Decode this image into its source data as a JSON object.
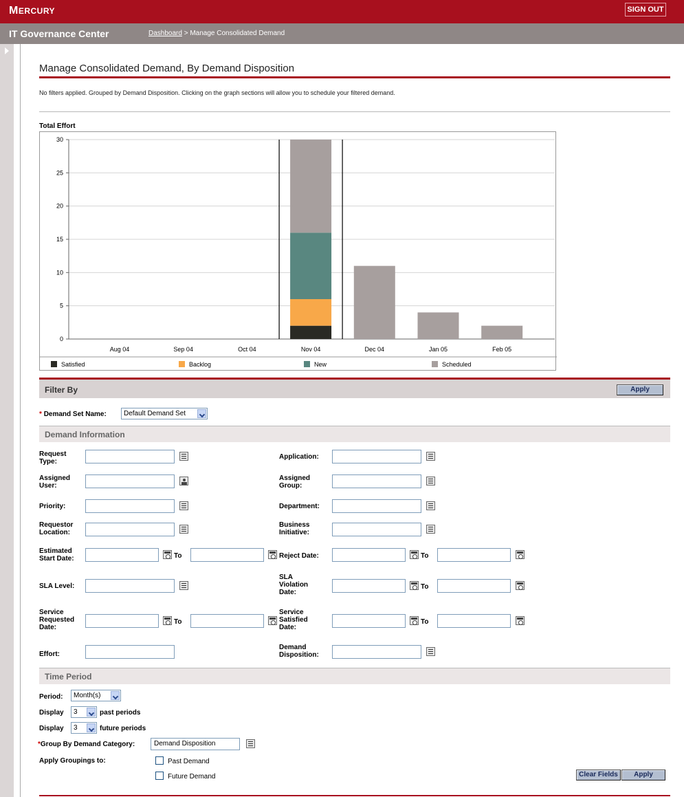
{
  "header": {
    "logo": "MERCURY",
    "sign_out": "SIGN OUT",
    "app_name": "IT Governance Center",
    "breadcrumb_link": "Dashboard",
    "breadcrumb_rest": " > Manage Consolidated Demand"
  },
  "page": {
    "title": "Manage Consolidated Demand, By Demand Disposition",
    "info": "No filters applied. Grouped by Demand Disposition. Clicking on the graph sections will allow you to schedule your filtered demand."
  },
  "chart_data": {
    "type": "bar",
    "title": "Total Effort",
    "categories": [
      "Aug 04",
      "Sep 04",
      "Oct 04",
      "Nov 04",
      "Dec 04",
      "Jan 05",
      "Feb 05"
    ],
    "series": [
      {
        "name": "Satisfied",
        "color": "#2a2a24",
        "values": [
          0,
          0,
          0,
          2,
          0,
          0,
          0
        ]
      },
      {
        "name": "Backlog",
        "color": "#f8a849",
        "values": [
          0,
          0,
          0,
          4,
          0,
          0,
          0
        ]
      },
      {
        "name": "New",
        "color": "#598780",
        "values": [
          0,
          0,
          0,
          10,
          0,
          0,
          0
        ]
      },
      {
        "name": "Scheduled",
        "color": "#a79f9e",
        "values": [
          0,
          0,
          0,
          14,
          11,
          4,
          2
        ]
      }
    ],
    "yticks": [
      "0",
      "5",
      "10",
      "15",
      "20",
      "25",
      "30"
    ],
    "ylim": [
      0,
      30
    ],
    "highlight_category": "Nov 04",
    "legend": "bottom",
    "grid": true
  },
  "filter": {
    "title": "Filter By",
    "apply": "Apply",
    "demand_set_label": "Demand Set Name:",
    "demand_set_value": "Default Demand Set",
    "demand_info": "Demand Information",
    "labels": {
      "request_type": [
        "Request",
        "Type:"
      ],
      "application": "Application:",
      "assigned_user": [
        "Assigned",
        "User:"
      ],
      "assigned_group": [
        "Assigned",
        "Group:"
      ],
      "priority": "Priority:",
      "department": "Department:",
      "requestor_location": [
        "Requestor",
        "Location:"
      ],
      "business_initiative": [
        "Business",
        "Initiative:"
      ],
      "est_start_date": [
        "Estimated",
        "Start Date:"
      ],
      "reject_date": "Reject Date:",
      "sla_level": "SLA Level:",
      "sla_violation_date": [
        "SLA",
        "Violation",
        "Date:"
      ],
      "service_requested_date": [
        "Service",
        "Requested",
        "Date:"
      ],
      "service_satisfied_date": [
        "Service",
        "Satisfied",
        "Date:"
      ],
      "effort": "Effort:",
      "demand_disposition": [
        "Demand",
        "Disposition:"
      ],
      "to": "To"
    },
    "time_period": "Time Period",
    "period_label": "Period:",
    "period_value": "Month(s)",
    "display_label": "Display",
    "past_value": "3",
    "past_label": "past periods",
    "future_value": "3",
    "future_label": "future periods",
    "group_by_label": "Group By Demand Category:",
    "group_by_value": "Demand Disposition",
    "apply_groupings_label": "Apply Groupings to:",
    "past_demand": "Past Demand",
    "future_demand": "Future Demand",
    "clear_fields": "Clear Fields"
  }
}
